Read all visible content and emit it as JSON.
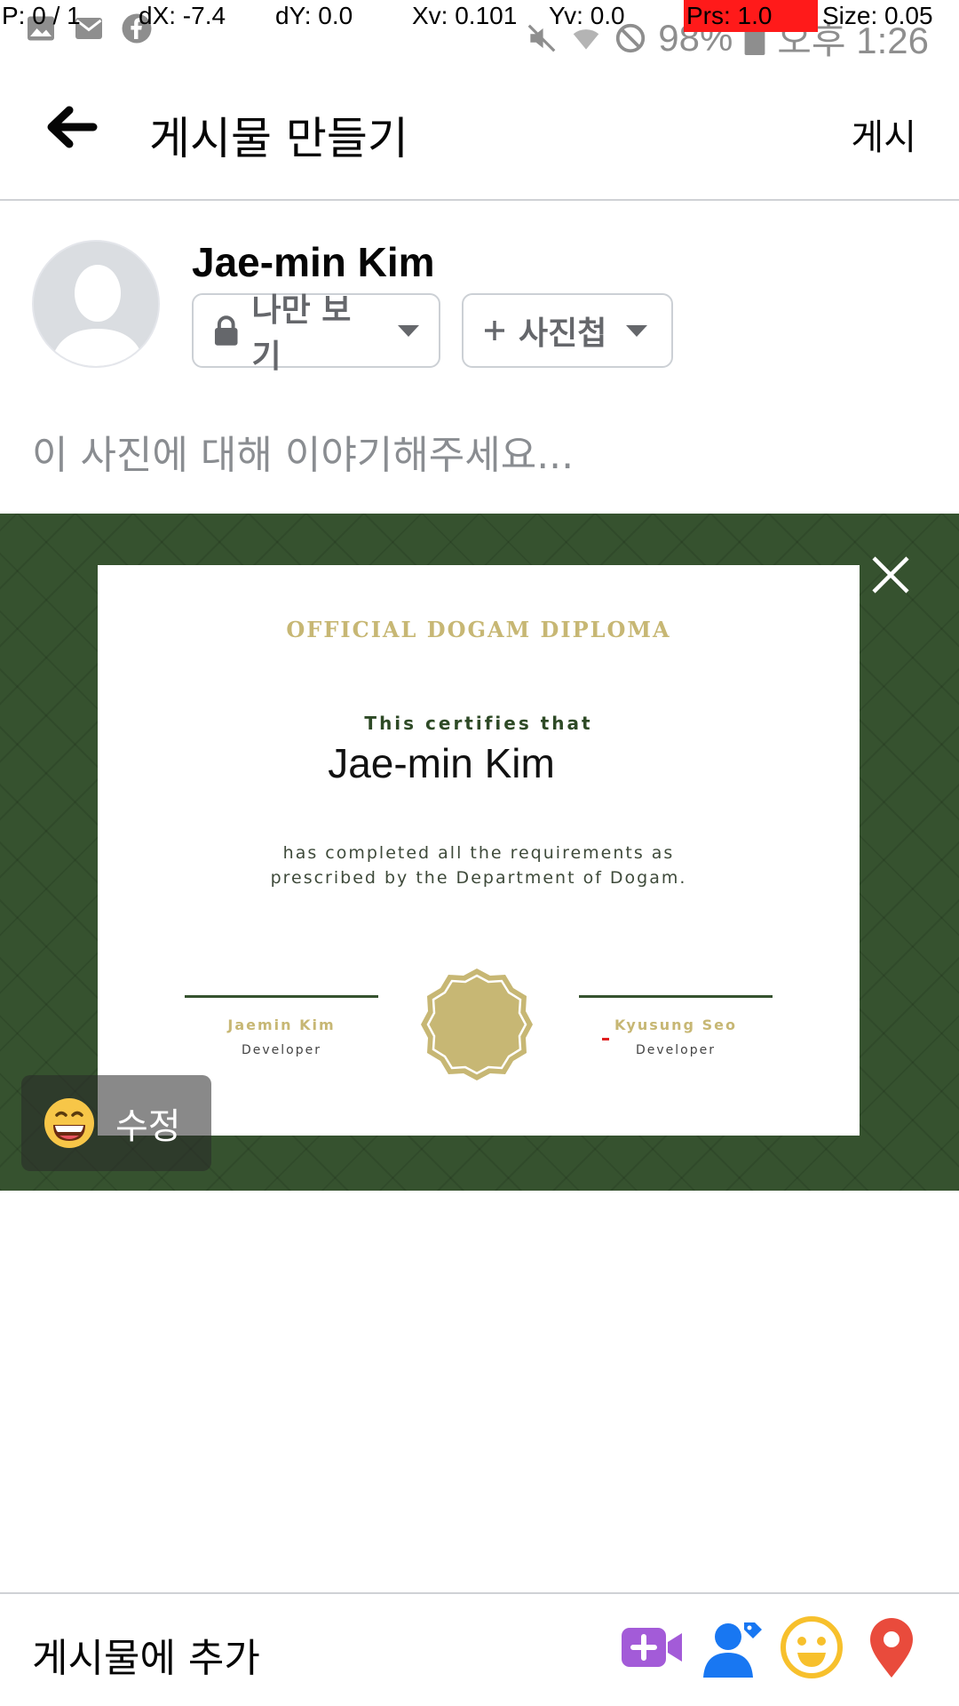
{
  "overlay": {
    "pointer": "P: 0 / 1",
    "dx": "dX: -7.4",
    "dy": "dY: 0.0",
    "xv": "Xv: 0.101",
    "yv": "Yv: 0.0",
    "prs": "Prs: 1.0",
    "size": "Size: 0.05"
  },
  "status_bar": {
    "battery": "98%",
    "time": "오후 1:26"
  },
  "header": {
    "title": "게시물 만들기",
    "post_label": "게시"
  },
  "author": {
    "name": "Jae-min Kim",
    "privacy_label": "나만 보기",
    "album_label": "사진첩"
  },
  "compose": {
    "placeholder": "이 사진에 대해 이야기해주세요..."
  },
  "certificate": {
    "title": "OFFICIAL DOGAM DIPLOMA",
    "certifies": "This certifies that",
    "recipient": "Jae-min Kim",
    "description_line1": "has completed all the requirements as",
    "description_line2": "prescribed by the Department of Dogam.",
    "signer_left_name": "Jaemin Kim",
    "signer_left_role": "Developer",
    "signer_right_name": "Kyusung Seo",
    "signer_right_role": "Developer"
  },
  "photo": {
    "edit_label": "수정"
  },
  "add_to_post": {
    "label": "게시물에 추가",
    "icons": [
      "video-add-icon",
      "tag-people-icon",
      "feeling-icon",
      "location-icon"
    ]
  },
  "colors": {
    "photo_bg": "#36522f",
    "gold": "#c7b774",
    "video_purple": "#a35bd8",
    "tag_blue": "#1877f2",
    "feeling_yellow": "#f7c02c",
    "location_red": "#e94b3c"
  }
}
